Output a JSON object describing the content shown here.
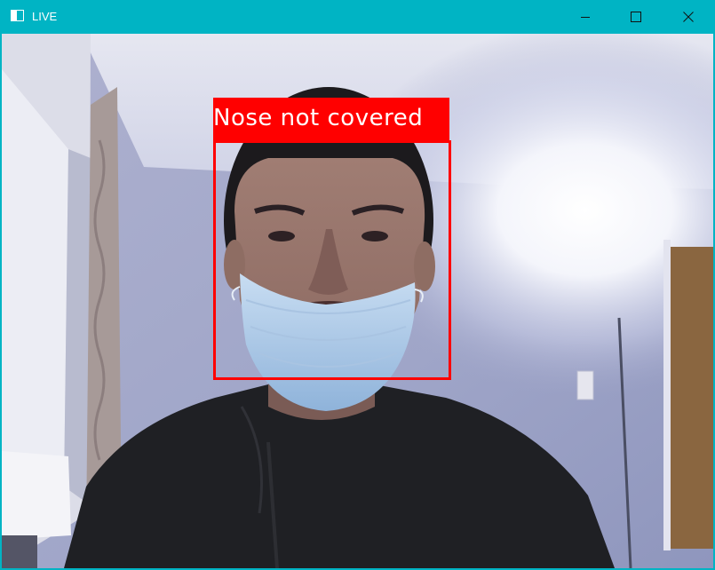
{
  "window": {
    "title": "LIVE",
    "controls": {
      "minimize": "minimize-icon",
      "maximize": "maximize-icon",
      "close": "close-icon"
    }
  },
  "detection": {
    "label": "Nose not covered",
    "box_color": "#ff0000",
    "label_text_color": "#ffffff"
  },
  "colors": {
    "titlebar": "#00b4c4"
  }
}
